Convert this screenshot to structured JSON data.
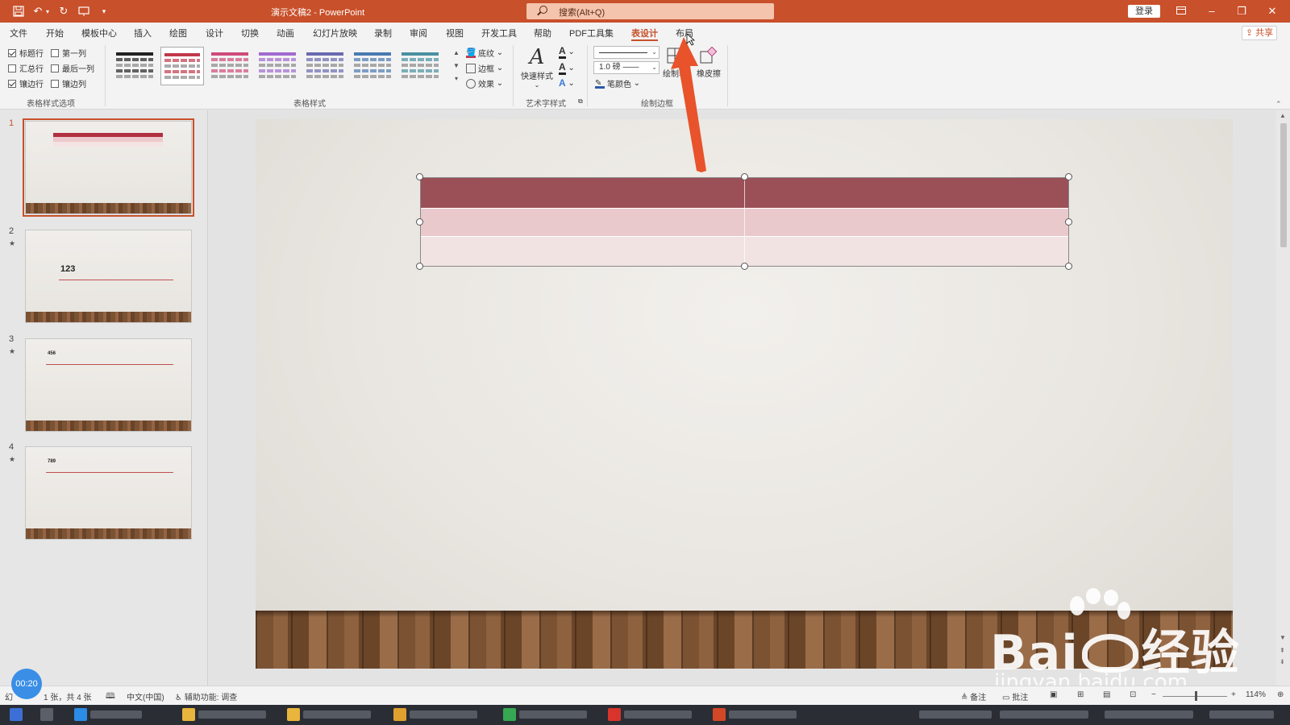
{
  "titlebar": {
    "doc_title": "演示文稿2 - PowerPoint",
    "search_placeholder": "搜索(Alt+Q)",
    "login": "登录",
    "window_buttons": [
      "ribbon-display-icon",
      "minimize-icon",
      "restore-icon",
      "close-icon"
    ]
  },
  "menu": {
    "tabs": [
      "文件",
      "开始",
      "模板中心",
      "插入",
      "绘图",
      "设计",
      "切换",
      "动画",
      "幻灯片放映",
      "录制",
      "审阅",
      "视图",
      "开发工具",
      "帮助",
      "PDF工具集",
      "表设计",
      "布局"
    ],
    "active_tab": "表设计",
    "share": "共享"
  },
  "ribbon": {
    "table_style_options": {
      "label": "表格样式选项",
      "options": [
        {
          "label": "标题行",
          "checked": true
        },
        {
          "label": "第一列",
          "checked": false
        },
        {
          "label": "汇总行",
          "checked": false
        },
        {
          "label": "最后一列",
          "checked": false
        },
        {
          "label": "镶边行",
          "checked": true
        },
        {
          "label": "镶边列",
          "checked": false
        }
      ]
    },
    "table_styles": {
      "label": "表格样式",
      "swatches": [
        "#222222",
        "#c0394a",
        "#d04a7a",
        "#a06ad0",
        "#6a6ab0",
        "#4a7ab0",
        "#4a90a0"
      ],
      "shading": "底纹",
      "borders": "边框",
      "effects": "效果"
    },
    "wordart": {
      "label": "艺术字样式",
      "quick_styles": "快速样式"
    },
    "draw_borders": {
      "label": "绘制边框",
      "pen_weight": "1.0 磅",
      "pen_color": "笔颜色",
      "draw_table": "绘制表",
      "eraser": "橡皮擦"
    }
  },
  "thumbnails": [
    {
      "num": "1",
      "text": "",
      "active": true
    },
    {
      "num": "2",
      "text": "123",
      "active": false
    },
    {
      "num": "3",
      "text": "456",
      "active": false
    },
    {
      "num": "4",
      "text": "789",
      "active": false
    }
  ],
  "status": {
    "slide_info": "1 张，共 4 张",
    "language": "中文(中国)",
    "accessibility": "辅助功能: 调查",
    "notes": "备注",
    "comments": "批注",
    "zoom": "114%",
    "timer": "00:20"
  },
  "watermark": {
    "brand": "Bai",
    "brand_tail": "经验",
    "url": "jingyan.baidu.com"
  }
}
